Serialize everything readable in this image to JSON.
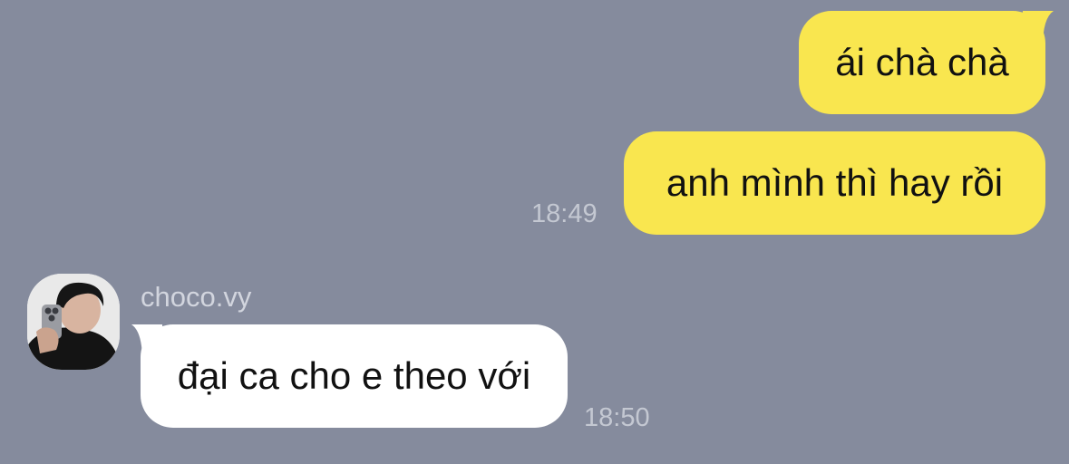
{
  "chat": {
    "background_color": "#858b9d",
    "outgoing_bubble_color": "#f9e64f",
    "incoming_bubble_color": "#ffffff",
    "messages_out": [
      {
        "text": "ái chà chà"
      },
      {
        "text": "anh mình thì hay rồi",
        "time": "18:49"
      }
    ],
    "incoming": {
      "sender": "choco.vy",
      "avatar_icon": "user-photo-icon",
      "text": "đại ca cho e theo với",
      "time": "18:50"
    }
  }
}
